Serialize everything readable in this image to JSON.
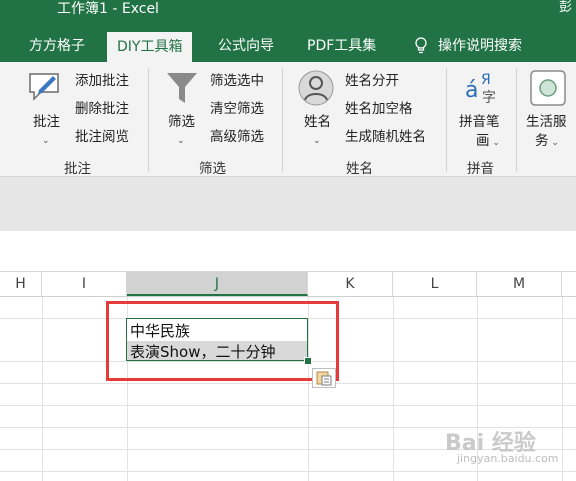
{
  "window": {
    "title": "工作簿1  -  Excel",
    "user_initial": "彭"
  },
  "tabs": [
    {
      "label": "方方格子",
      "active": false
    },
    {
      "label": "DIY工具箱",
      "active": true
    },
    {
      "label": "公式向导",
      "active": false
    },
    {
      "label": "PDF工具集",
      "active": false
    },
    {
      "label": "操作说明搜索",
      "active": false,
      "icon": "lightbulb-icon"
    }
  ],
  "ribbon": {
    "groups": [
      {
        "name": "批注",
        "big_button": {
          "label": "批注",
          "icon": "comment-icon"
        },
        "items": [
          "添加批注",
          "删除批注",
          "批注阅览"
        ]
      },
      {
        "name": "筛选",
        "big_button": {
          "label": "筛选",
          "icon": "funnel-icon"
        },
        "items": [
          "筛选选中",
          "清空筛选",
          "高级筛选"
        ]
      },
      {
        "name": "姓名",
        "big_button": {
          "label": "姓名",
          "icon": "person-icon"
        },
        "items": [
          "姓名分开",
          "姓名加空格",
          "生成随机姓名"
        ]
      },
      {
        "name": "拼音",
        "big_button": {
          "label": "拼音笔画",
          "line1": "拼音笔",
          "line2": "画",
          "icon": "pinyin-icon"
        }
      },
      {
        "name": "",
        "big_button": {
          "label": "生活服务",
          "line1": "生活服",
          "line2": "务",
          "icon": "life-service-icon"
        }
      }
    ]
  },
  "sheet": {
    "columns": [
      "H",
      "I",
      "J",
      "K",
      "L",
      "M"
    ],
    "selected_column": "J",
    "active_cell": {
      "line1": "中华民族",
      "line2": "表演Show，二十分钟"
    }
  },
  "watermark": {
    "text": "Bai 经验",
    "url": "jingyan.baidu.com"
  },
  "colors": {
    "excel_green": "#217346",
    "highlight_red": "#e63b3b"
  }
}
